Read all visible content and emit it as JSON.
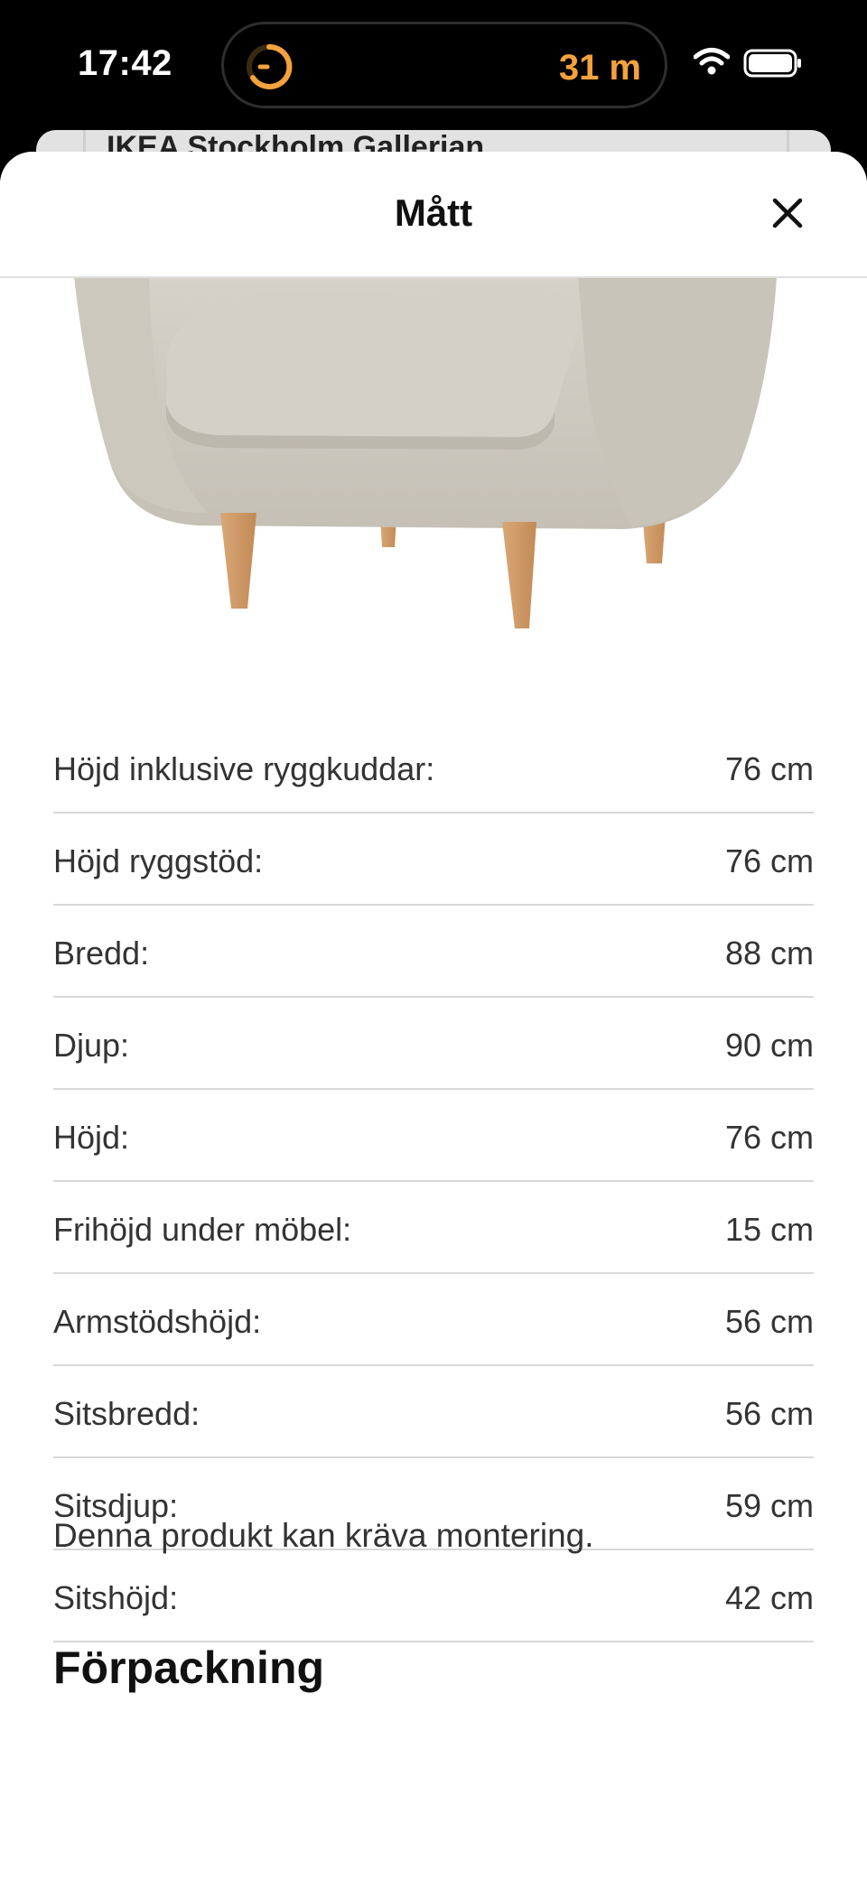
{
  "status_bar": {
    "time": "17:42",
    "live_activity": "31 m",
    "accent_color": "#f4a23d",
    "icons": [
      "timer-icon",
      "wifi-icon",
      "battery-icon"
    ]
  },
  "background_sheet": {
    "title": "IKEA Stockholm Gallerian"
  },
  "modal": {
    "title": "Mått",
    "close_icon": "close-icon"
  },
  "product_image": {
    "alt": "armchair-beige-with-wooden-legs"
  },
  "dimensions": [
    {
      "label": "Höjd inklusive ryggkuddar:",
      "value": "76 cm"
    },
    {
      "label": "Höjd ryggstöd:",
      "value": "76 cm"
    },
    {
      "label": "Bredd:",
      "value": "88 cm"
    },
    {
      "label": "Djup:",
      "value": "90 cm"
    },
    {
      "label": "Höjd:",
      "value": "76 cm"
    },
    {
      "label": "Frihöjd under möbel:",
      "value": "15 cm"
    },
    {
      "label": "Armstödshöjd:",
      "value": "56 cm"
    },
    {
      "label": "Sitsbredd:",
      "value": "56 cm"
    },
    {
      "label": "Sitsdjup:",
      "value": "59 cm"
    },
    {
      "label": "Sitshöjd:",
      "value": "42 cm"
    }
  ],
  "note": "Denna produkt kan kräva montering.",
  "packaging_heading": "Förpackning"
}
